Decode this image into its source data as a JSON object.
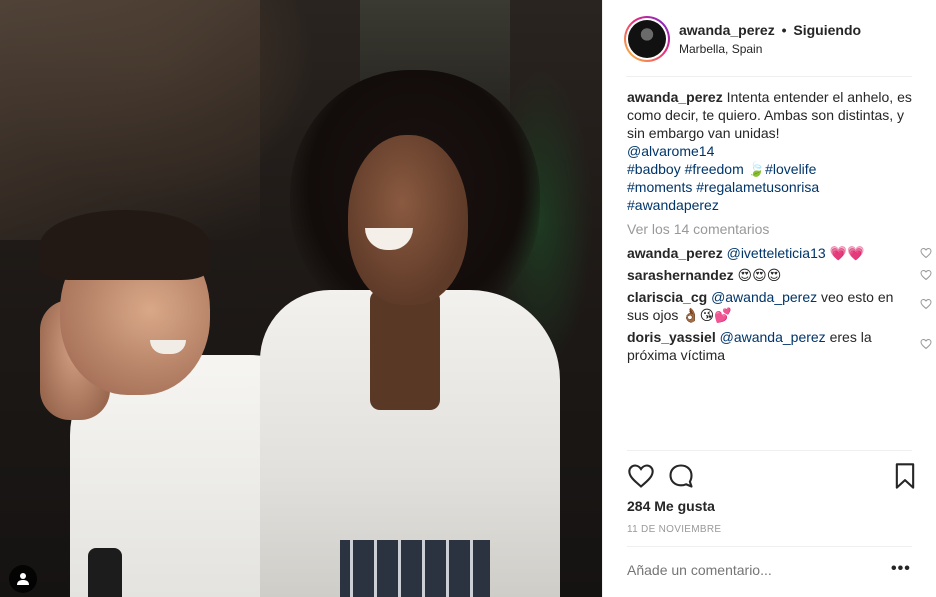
{
  "post": {
    "username": "awanda_perez",
    "separator": "•",
    "follow_status": "Siguiendo",
    "location": "Marbella, Spain"
  },
  "caption": {
    "username": "awanda_perez",
    "text": "Intenta entender el anhelo, es como decir, te quiero. Ambas son distintas, y sin embargo van unidas!",
    "mention": "@alvarome14",
    "tags_line1": [
      "#badboy",
      "#freedom",
      "🍃",
      "#lovelife"
    ],
    "tags_line2": [
      "#moments",
      "#regalametusonrisa"
    ],
    "tags_line3": [
      "#awandaperez"
    ]
  },
  "view_all_comments": "Ver los 14 comentarios",
  "comments": [
    {
      "username": "awanda_perez",
      "mention": "@ivetteleticia13",
      "text": "",
      "emoji": "💗💗"
    },
    {
      "username": "sarashernandez",
      "mention": "",
      "text": "",
      "emoji": "😍😍😍"
    },
    {
      "username": "clariscia_cg",
      "mention": "@awanda_perez",
      "text": "veo esto en sus ojos",
      "emoji": "👌🏾😘💕"
    },
    {
      "username": "doris_yassiel",
      "mention": "@awanda_perez",
      "text": "eres la próxima víctima",
      "emoji": ""
    }
  ],
  "likes": "284 Me gusta",
  "date": "11 DE NOVIEMBRE",
  "add_comment_placeholder": "Añade un comentario...",
  "more_options": "•••",
  "icons": {
    "like": "heart-icon",
    "comment": "comment-icon",
    "save": "bookmark-icon",
    "comment_like": "heart-icon",
    "user_tag": "user-tag-icon"
  }
}
